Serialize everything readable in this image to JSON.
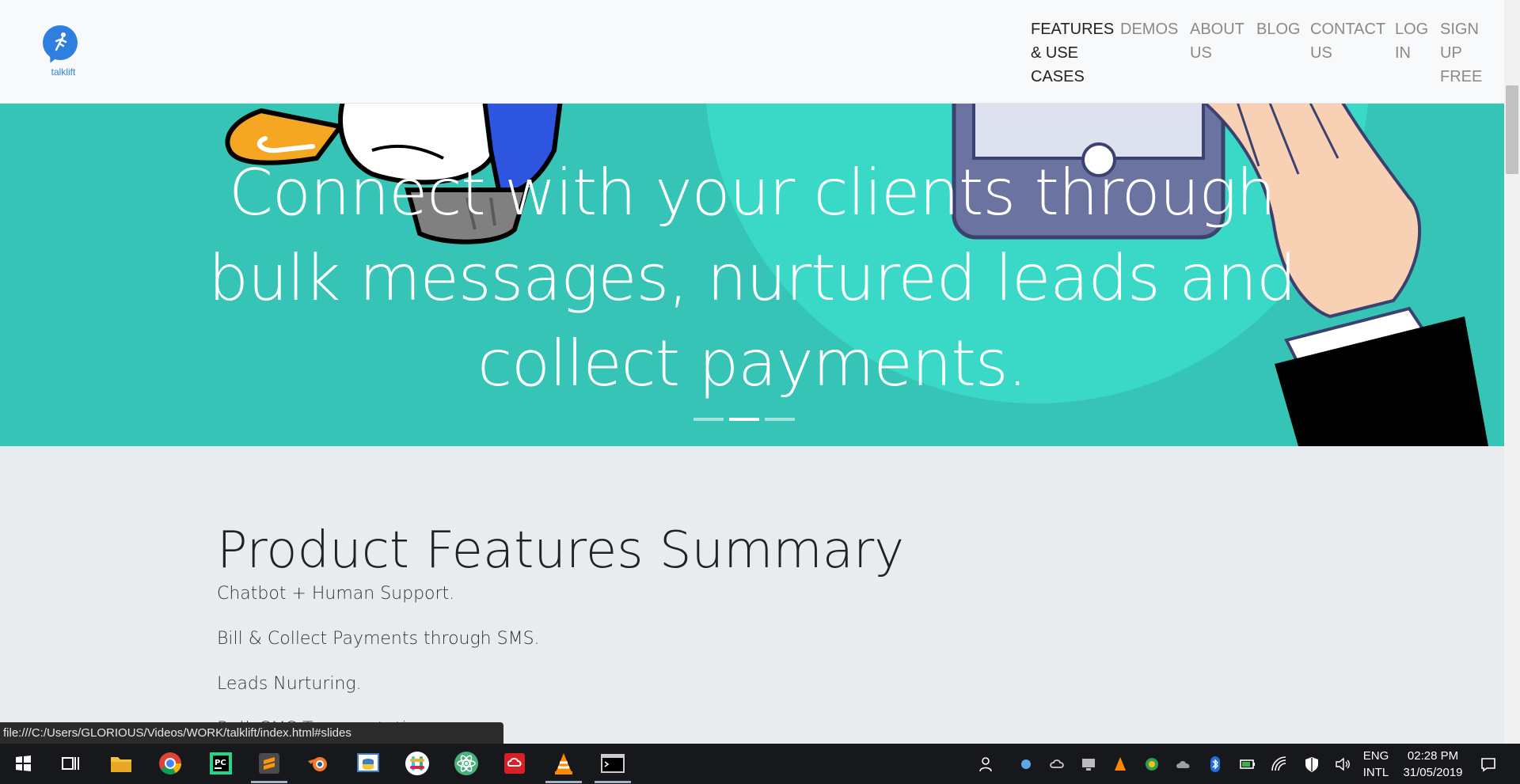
{
  "logo": {
    "text": "talklift",
    "color": "#2f7fe0"
  },
  "nav": {
    "items": [
      {
        "label": "FEATURES\n& USE\nCASES",
        "active": true
      },
      {
        "label": "DEMOS"
      },
      {
        "label": "ABOUT\nUS"
      },
      {
        "label": "BLOG"
      },
      {
        "label": "CONTACT\nUS"
      },
      {
        "label": "LOG\nIN"
      },
      {
        "label": "SIGN\nUP\nFREE"
      }
    ]
  },
  "hero": {
    "heading": "Connect with your clients through bulk messages, nurtured leads and collect payments.",
    "background": "#35c4b5",
    "slide_count": 3,
    "active_slide": 2
  },
  "summary": {
    "title": "Product Features Summary",
    "features": [
      "Chatbot + Human Support.",
      "Bill & Collect Payments through SMS.",
      "Leads Nurturing.",
      "Bulk SMS Transportation."
    ]
  },
  "status_bar": {
    "url": "file:///C:/Users/GLORIOUS/Videos/WORK/talklift/index.html#slides"
  },
  "taskbar": {
    "apps": [
      "windows-start-icon",
      "task-view-icon",
      "file-explorer-icon",
      "chrome-icon",
      "pycharm-icon",
      "sublime-text-icon",
      "blender-icon",
      "python-idle-icon",
      "slack-icon",
      "atom-icon",
      "creative-cloud-icon",
      "vlc-icon",
      "terminal-icon"
    ],
    "language": [
      "ENG",
      "INTL"
    ],
    "time": "02:28 PM",
    "date": "31/05/2019"
  }
}
